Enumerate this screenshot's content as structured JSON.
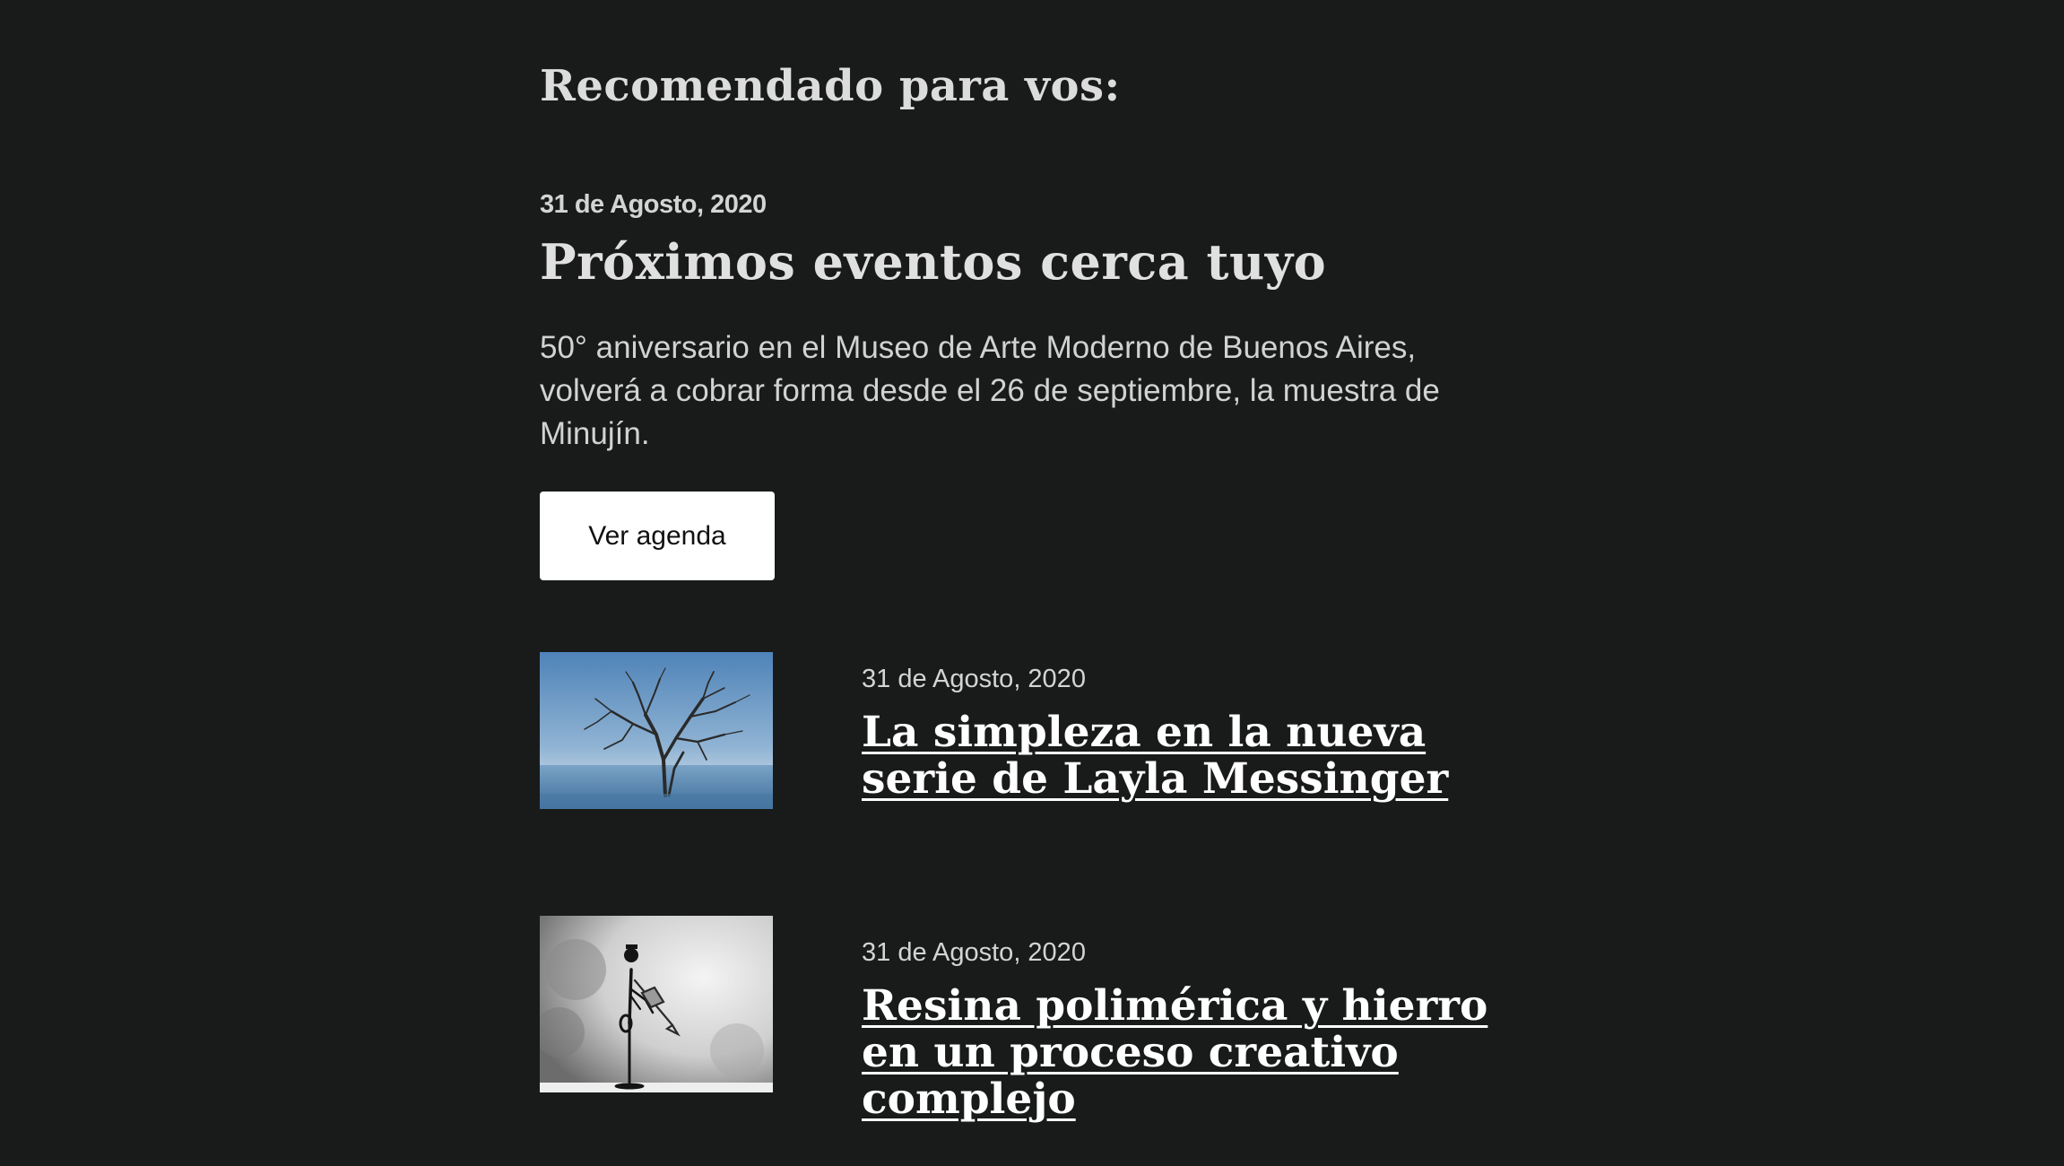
{
  "section": {
    "title": "Recomendado para vos:"
  },
  "featured": {
    "date": "31 de Agosto, 2020",
    "title": "Próximos eventos cerca tuyo",
    "description": "50° aniversario en el Museo de Arte Moderno de Buenos Aires, volverá a cobrar forma desde el 26 de septiembre, la muestra de Minujín.",
    "button_label": "Ver agenda"
  },
  "articles": [
    {
      "date": "31 de Agosto, 2020",
      "title": "La simpleza en la nueva serie de Layla Messinger",
      "image": "tree-in-water-photo"
    },
    {
      "date": "31 de Agosto, 2020",
      "title": "Resina polimérica y hierro en un proceso creativo complejo",
      "image": "trumpet-player-sculpture-photo"
    }
  ],
  "colors": {
    "background": "#191a1a",
    "text": "#e6e6e6",
    "button_bg": "#ffffff",
    "button_text": "#111111"
  }
}
